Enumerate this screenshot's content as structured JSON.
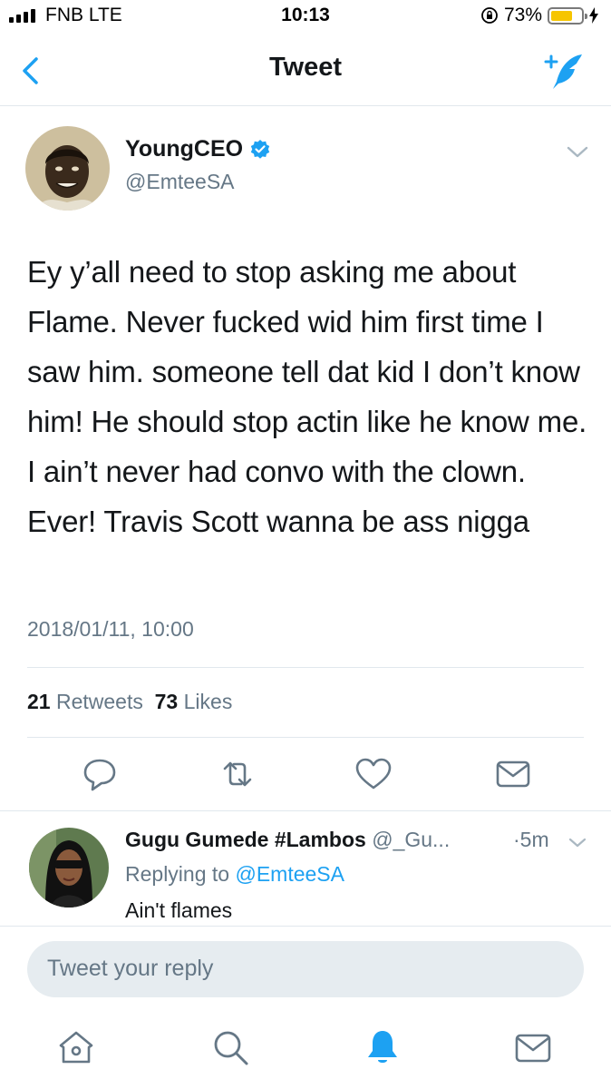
{
  "status_bar": {
    "carrier": "FNB LTE",
    "time": "10:13",
    "battery_level_label": "73%",
    "battery_level": 0.73
  },
  "nav": {
    "title": "Tweet",
    "back_icon": "chevron-left-icon",
    "compose_icon": "compose-tweet-icon"
  },
  "tweet": {
    "author_name": "YoungCEO",
    "author_handle": "@EmteeSA",
    "verified_icon": "verified-badge-icon",
    "text": "Ey y’all need to stop asking me about Flame. Never fucked wid him first time I saw him. someone tell dat kid I don’t know him! He should stop actin like he know me. I ain’t never had convo with the clown. Ever! Travis Scott wanna be ass nigga",
    "timestamp": "2018/01/11, 10:00",
    "retweets_count": "21",
    "retweets_label": "Retweets",
    "likes_count": "73",
    "likes_label": "Likes"
  },
  "reply": {
    "author_name": "Gugu Gumede #Lambos",
    "author_handle": "@_Gu...",
    "time": "·5m",
    "replying_prefix": "Replying to",
    "replying_to": "@EmteeSA",
    "text": "Ain't flames"
  },
  "compose": {
    "placeholder": "Tweet your reply"
  },
  "tabs": [
    "home-icon",
    "search-icon",
    "notifications-icon",
    "messages-icon"
  ],
  "colors": {
    "accent": "#1da1f2",
    "secondary_text": "#657786",
    "battery": "#f6c500"
  }
}
